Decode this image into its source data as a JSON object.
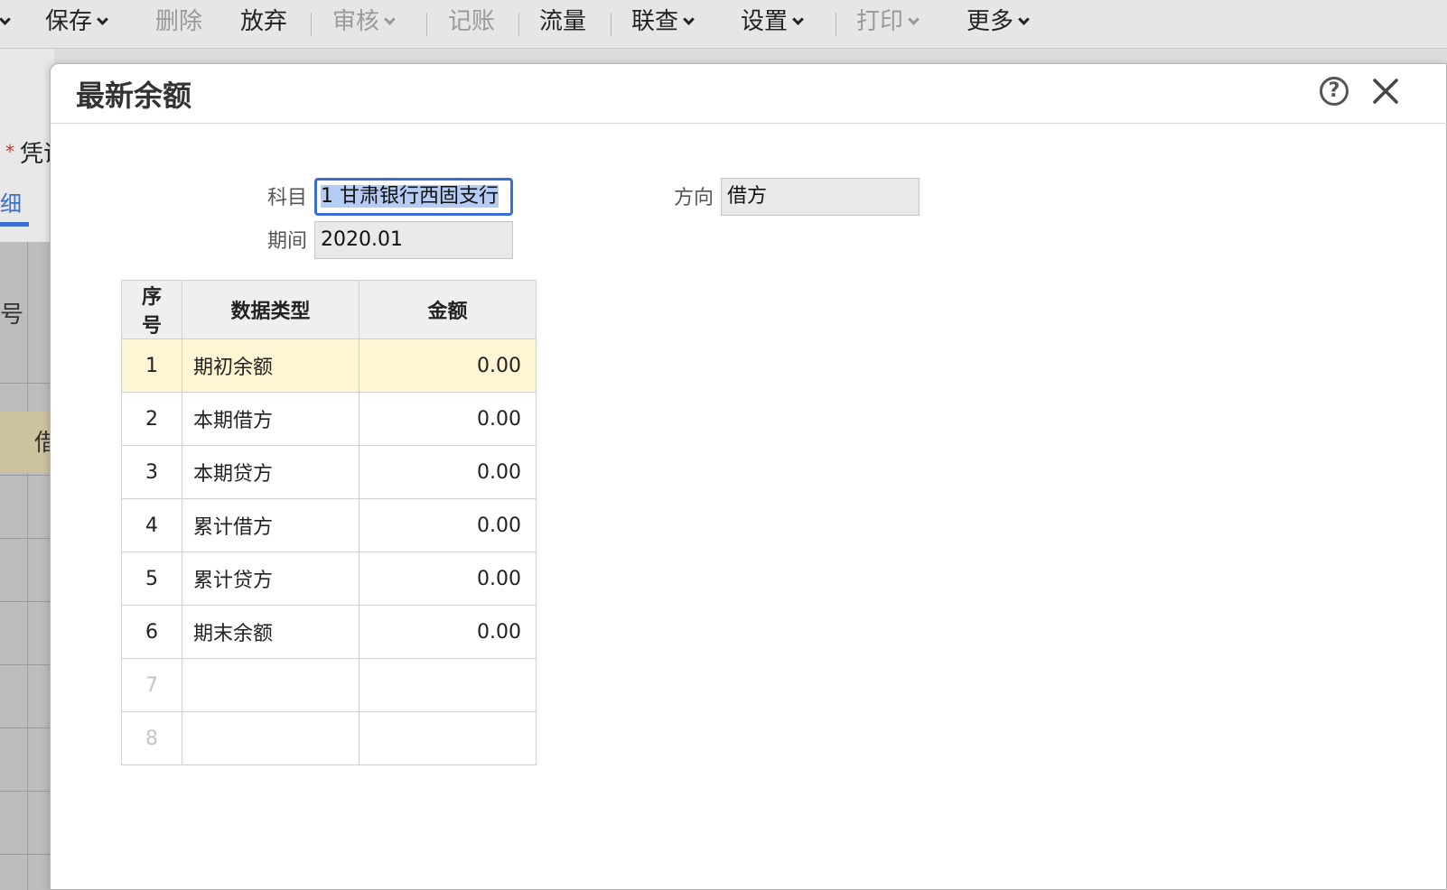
{
  "toolbar": {
    "items": [
      {
        "label": "保存",
        "dropdown": true,
        "disabled": false
      },
      {
        "label": "删除",
        "dropdown": false,
        "disabled": true
      },
      {
        "label": "放弃",
        "dropdown": false,
        "disabled": false
      },
      {
        "label": "审核",
        "dropdown": true,
        "disabled": true
      },
      {
        "label": "记账",
        "dropdown": false,
        "disabled": true
      },
      {
        "label": "流量",
        "dropdown": false,
        "disabled": false
      },
      {
        "label": "联查",
        "dropdown": true,
        "disabled": false
      },
      {
        "label": "设置",
        "dropdown": true,
        "disabled": false
      },
      {
        "label": "打印",
        "dropdown": true,
        "disabled": true
      },
      {
        "label": "更多",
        "dropdown": true,
        "disabled": false
      }
    ]
  },
  "background": {
    "partial_label": "凭证",
    "partial_tab": "细",
    "partial_header": "号",
    "partial_cell": "借"
  },
  "dialog": {
    "title": "最新余额",
    "form": {
      "subject_label": "科目",
      "subject_value": "1 甘肃银行西固支行",
      "period_label": "期间",
      "period_value": "2020.01",
      "direction_label": "方向",
      "direction_value": "借方"
    },
    "table": {
      "headers": [
        "序号",
        "数据类型",
        "金额"
      ],
      "rows": [
        {
          "idx": "1",
          "type": "期初余额",
          "amount": "0.00"
        },
        {
          "idx": "2",
          "type": "本期借方",
          "amount": "0.00"
        },
        {
          "idx": "3",
          "type": "本期贷方",
          "amount": "0.00"
        },
        {
          "idx": "4",
          "type": "累计借方",
          "amount": "0.00"
        },
        {
          "idx": "5",
          "type": "累计贷方",
          "amount": "0.00"
        },
        {
          "idx": "6",
          "type": "期末余额",
          "amount": "0.00"
        },
        {
          "idx": "7",
          "type": "",
          "amount": ""
        },
        {
          "idx": "8",
          "type": "",
          "amount": ""
        }
      ]
    }
  },
  "colors": {
    "accent": "#3b6fcf",
    "highlight_row": "#fdf5d3"
  }
}
